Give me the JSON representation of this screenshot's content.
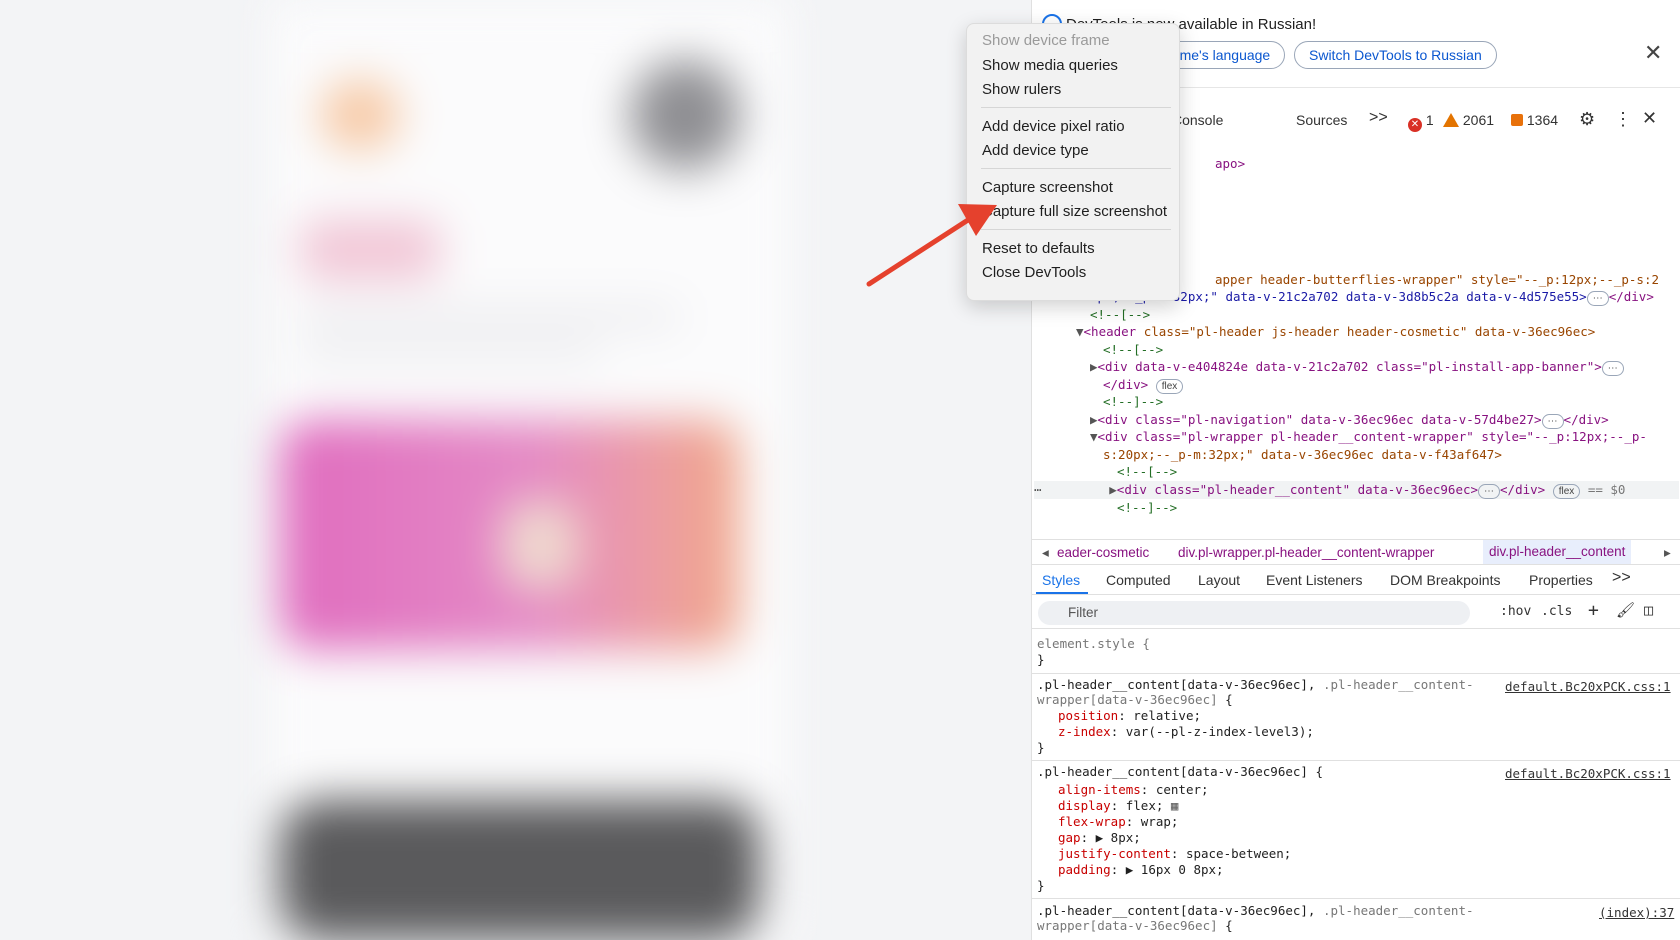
{
  "devtools": {
    "infobar": {
      "text": "DevTools is now available in Russian!",
      "language_button": "Always match Chrome's language",
      "switch_button": "Switch DevTools to Russian"
    },
    "tabs": {
      "console": "Console",
      "sources": "Sources",
      "more": ">>",
      "errors": "1",
      "warnings": "2061",
      "issues": "1364"
    },
    "dom": {
      "top_line": "apo>",
      "l1": "apper header-butterflies-wrapper\" style=\"--_p:12px;--_p-s:2",
      "l2": "0px;--_p-m:32px;\" data-v-21c2a702 data-v-3d8b5c2a data-v-4d575e55>",
      "l2b": "</div>",
      "l3": "<!--[-->",
      "l4_tag": "<header",
      "l4_rest": " class=\"pl-header js-header header-cosmetic\" data-v-36ec96ec>",
      "l5": "<!--[-->",
      "l6": "<div data-v-e404824e data-v-21c2a702 class=\"pl-install-app-banner\">",
      "l7": "</div>",
      "l7_badge": "flex",
      "l8": "<!--]-->",
      "l9": "<div class=\"pl-navigation\" data-v-36ec96ec data-v-57d4be27>",
      "l9b": "</div>",
      "l10": "<div class=\"pl-wrapper pl-header__content-wrapper\" style=\"--_p:12px;--_p-",
      "l11": "s:20px;--_p-m:32px;\" data-v-36ec96ec data-v-f43af647>",
      "l12": "<!--[-->",
      "l13": "<div class=\"pl-header__content\" data-v-36ec96ec>",
      "l13b": "</div>",
      "l13_badge": "flex",
      "l13_dollar": "== $0",
      "l14": "<!--]-->"
    },
    "breadcrumbs": [
      "eader-cosmetic",
      "div.pl-wrapper.pl-header__content-wrapper",
      "div.pl-header__content"
    ],
    "subtabs": [
      "Styles",
      "Computed",
      "Layout",
      "Event Listeners",
      "DOM Breakpoints",
      "Properties",
      ">>"
    ],
    "filter": {
      "placeholder": "Filter",
      "hov": ":hov",
      "cls": ".cls",
      "plus": "+"
    },
    "styles": {
      "r0_sel": "element.style {",
      "r0_end": "}",
      "r1_sel": ".pl-header__content[data-v-36ec96ec],",
      "r1_sel2": " .pl-header__content-",
      "r1_sel3": "wrapper[data-v-36ec96ec]",
      "r1_brace": " {",
      "r1_src": "default.Bc20xPCK.css:1",
      "r1_p1": "position",
      "r1_v1": ": relative;",
      "r1_p2": "z-index",
      "r1_v2": ": var(--pl-z-index-level3);",
      "r1_end": "}",
      "r2_sel": ".pl-header__content[data-v-36ec96ec] {",
      "r2_src": "default.Bc20xPCK.css:1",
      "r2_p1": "align-items",
      "r2_v1": ": center;",
      "r2_p2": "display",
      "r2_v2": ": flex;",
      "r2_p3": "flex-wrap",
      "r2_v3": ": wrap;",
      "r2_p4": "gap",
      "r2_v4": ": ▶ 8px;",
      "r2_p5": "justify-content",
      "r2_v5": ": space-between;",
      "r2_p6": "padding",
      "r2_v6": ": ▶ 16px 0 8px;",
      "r2_end": "}",
      "r3_sel": ".pl-header__content[data-v-36ec96ec],",
      "r3_sel2": " .pl-header__content-",
      "r3_sel3": "wrapper[data-v-36ec96ec]",
      "r3_brace": " {",
      "r3_src": "(index):37"
    }
  },
  "context_menu": {
    "items": [
      {
        "label": "Show device frame",
        "disabled": true
      },
      {
        "label": "Show media queries"
      },
      {
        "label": "Show rulers"
      },
      {
        "label": "Add device pixel ratio"
      },
      {
        "label": "Add device type"
      },
      {
        "label": "Capture screenshot"
      },
      {
        "label": "Capture full size screenshot"
      },
      {
        "label": "Reset to defaults"
      },
      {
        "label": "Close DevTools"
      }
    ]
  },
  "colors": {
    "arrow": "#e5412d",
    "accent": "#1a73e8"
  }
}
